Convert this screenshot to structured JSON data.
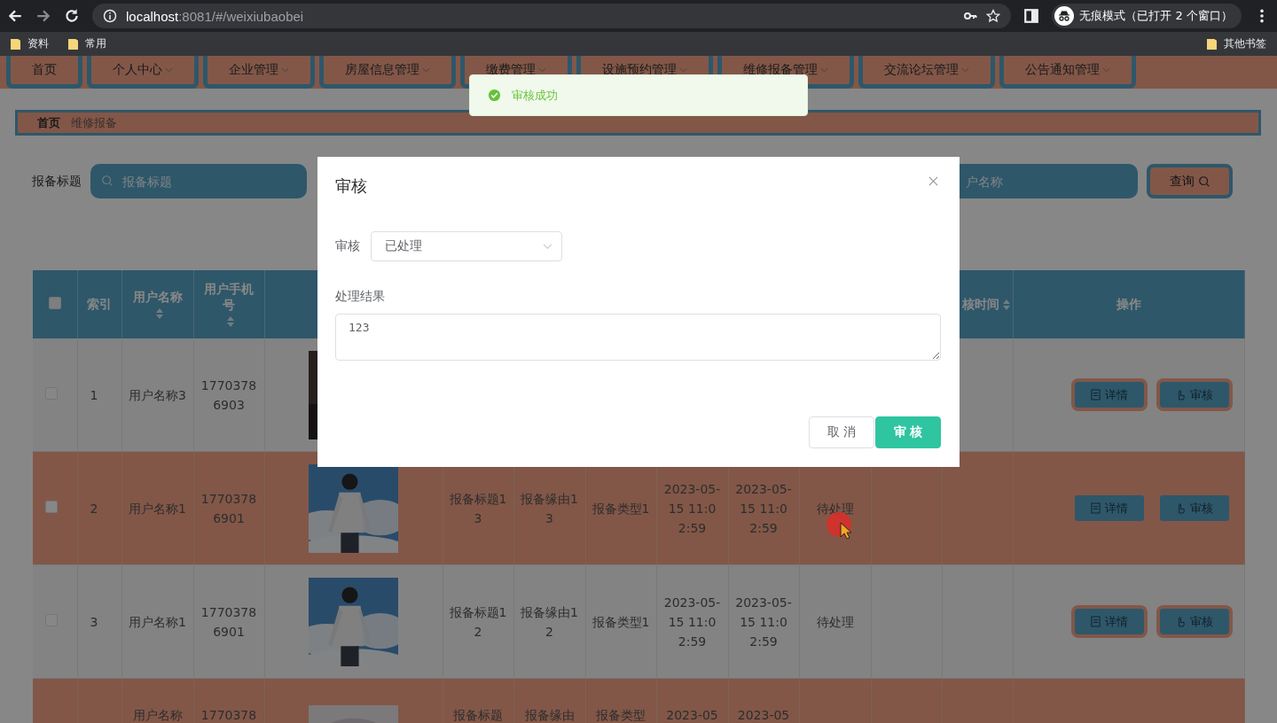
{
  "browser": {
    "host": "localhost",
    "path": ":8081/#/weixiubaobei",
    "incognito": "无痕模式（已打开 2 个窗口）",
    "bookmarks": [
      "资料",
      "常用"
    ],
    "other_bookmarks": "其他书签"
  },
  "nav": [
    {
      "label": "首页",
      "dropdown": false
    },
    {
      "label": "个人中心",
      "dropdown": true
    },
    {
      "label": "企业管理",
      "dropdown": true
    },
    {
      "label": "房屋信息管理",
      "dropdown": true
    },
    {
      "label": "缴费管理",
      "dropdown": true
    },
    {
      "label": "设施预约管理",
      "dropdown": true
    },
    {
      "label": "维修报备管理",
      "dropdown": true
    },
    {
      "label": "交流论坛管理",
      "dropdown": true
    },
    {
      "label": "公告通知管理",
      "dropdown": true
    }
  ],
  "toast": {
    "message": "审核成功"
  },
  "breadcrumb": [
    {
      "label": "首页",
      "current": false
    },
    {
      "label": "维修报备",
      "current": true
    }
  ],
  "search": {
    "label": "报备标题",
    "fields": [
      {
        "placeholder": "报备标题"
      },
      {
        "placeholder": "户名称"
      }
    ],
    "button": "查询"
  },
  "table": {
    "columns": [
      {
        "kind": "checkbox",
        "checked": false
      },
      {
        "kind": "text",
        "label": "索引",
        "sortable": false
      },
      {
        "kind": "text",
        "label": "用户名称",
        "sortable": true
      },
      {
        "kind": "text",
        "label": "用户手机号",
        "sortable": true
      },
      {
        "kind": "empty"
      },
      {
        "kind": "empty"
      },
      {
        "kind": "empty"
      },
      {
        "kind": "empty"
      },
      {
        "kind": "empty"
      },
      {
        "kind": "empty"
      },
      {
        "kind": "empty"
      },
      {
        "kind": "empty"
      },
      {
        "kind": "text",
        "label": "核时间",
        "sortable": true
      },
      {
        "kind": "text",
        "label": "操作",
        "sortable": false
      }
    ],
    "rows": [
      {
        "highlight": false,
        "cut": false,
        "cells": [
          {
            "kind": "checkbox",
            "checked": false
          },
          {
            "kind": "text",
            "text": "1"
          },
          {
            "kind": "text",
            "text": "用户名称3"
          },
          {
            "kind": "text",
            "text": "17703786903"
          },
          {
            "kind": "picture"
          },
          {
            "kind": "empty"
          },
          {
            "kind": "empty"
          },
          {
            "kind": "empty"
          },
          {
            "kind": "empty"
          },
          {
            "kind": "empty"
          },
          {
            "kind": "empty"
          },
          {
            "kind": "empty"
          },
          {
            "kind": "empty"
          },
          {
            "kind": "actions",
            "buttons": [
              "详情",
              "审核"
            ]
          }
        ]
      },
      {
        "highlight": true,
        "cut": false,
        "cells": [
          {
            "kind": "checkbox",
            "checked": false
          },
          {
            "kind": "text",
            "text": "2"
          },
          {
            "kind": "text",
            "text": "用户名称1"
          },
          {
            "kind": "text",
            "text": "17703786901"
          },
          {
            "kind": "picture"
          },
          {
            "kind": "text",
            "text": "报备标题13"
          },
          {
            "kind": "text",
            "text": "报备缘由13"
          },
          {
            "kind": "text",
            "text": "报备类型1"
          },
          {
            "kind": "text",
            "text": "2023-05-15 11:02:59"
          },
          {
            "kind": "text",
            "text": "2023-05-15 11:02:59"
          },
          {
            "kind": "text",
            "text": "待处理"
          },
          {
            "kind": "empty"
          },
          {
            "kind": "empty"
          },
          {
            "kind": "actions",
            "buttons": [
              "详情",
              "审核"
            ]
          }
        ]
      },
      {
        "highlight": false,
        "cut": false,
        "cells": [
          {
            "kind": "checkbox",
            "checked": false
          },
          {
            "kind": "text",
            "text": "3"
          },
          {
            "kind": "text",
            "text": "用户名称1"
          },
          {
            "kind": "text",
            "text": "17703786901"
          },
          {
            "kind": "picture"
          },
          {
            "kind": "text",
            "text": "报备标题12"
          },
          {
            "kind": "text",
            "text": "报备缘由12"
          },
          {
            "kind": "text",
            "text": "报备类型1"
          },
          {
            "kind": "text",
            "text": "2023-05-15 11:02:59"
          },
          {
            "kind": "text",
            "text": "2023-05-15 11:02:59"
          },
          {
            "kind": "text",
            "text": "待处理"
          },
          {
            "kind": "empty"
          },
          {
            "kind": "empty"
          },
          {
            "kind": "actions",
            "buttons": [
              "详情",
              "审核"
            ]
          }
        ]
      },
      {
        "highlight": true,
        "cut": true,
        "cells": [
          {
            "kind": "empty"
          },
          {
            "kind": "empty"
          },
          {
            "kind": "text",
            "text": "用户名称"
          },
          {
            "kind": "text",
            "text": "1770378"
          },
          {
            "kind": "picture"
          },
          {
            "kind": "text",
            "text": "报备标题"
          },
          {
            "kind": "text",
            "text": "报备缘由"
          },
          {
            "kind": "text",
            "text": "报备类型"
          },
          {
            "kind": "text",
            "text": "2023-05"
          },
          {
            "kind": "text",
            "text": "2023-05"
          },
          {
            "kind": "empty"
          },
          {
            "kind": "empty"
          },
          {
            "kind": "empty"
          },
          {
            "kind": "empty"
          }
        ]
      }
    ]
  },
  "dialog": {
    "title": "审核",
    "fields": [
      {
        "kind": "select",
        "label": "审核",
        "value": "已处理"
      },
      {
        "kind": "textarea",
        "label": "处理结果",
        "value": "123"
      }
    ],
    "buttons": [
      {
        "label": "取 消",
        "primary": false
      },
      {
        "label": "审 核",
        "primary": true
      }
    ]
  }
}
